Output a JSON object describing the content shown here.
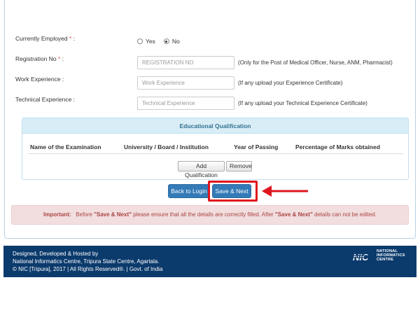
{
  "form": {
    "employed": {
      "label": "Currently Employed",
      "required": "*",
      "suffix": " :",
      "options": [
        "Yes",
        "No"
      ],
      "selected": "No"
    },
    "registration": {
      "label": "Registration No",
      "required": "*",
      "suffix": " :",
      "placeholder": "REGISTRATION NO",
      "hint": "(Only for the Post of Medical Officer, Nurse, ANM, Pharmacist)"
    },
    "work": {
      "label": "Work Experience :",
      "placeholder": "Work Experience",
      "hint": "(If any upload your Experience Certificate)"
    },
    "technical": {
      "label": "Technical Experience :",
      "placeholder": "Technical Experience",
      "hint": "(If any upload your Technical Experience Certificate)"
    }
  },
  "qualification": {
    "title": "Educational Qualification",
    "columns": [
      "Name of the Examination",
      "University / Board / Institution",
      "Year of Passing",
      "Percentage of Marks obtained"
    ],
    "add_label": "Add Qualification",
    "remove_label": "Remove"
  },
  "actions": {
    "back_label": "Back to Login",
    "save_label": "Save & Next"
  },
  "alert": {
    "important": "Important:",
    "text1": "Before ",
    "emph1": "\"Save & Next\"",
    "text2": " please ensure that all the details are correctly filled. After ",
    "emph2": "\"Save & Next\"",
    "text3": " details can not be edited."
  },
  "footer": {
    "line1": "Designed, Developed & Hosted by",
    "line2": "National Informatics Centre, Tripura State Centre, Agartala.",
    "line3": "© NIC [Tripura], 2017 | All Rights Reserved®. | Govt. of India",
    "logo_mark": "NIC",
    "logo_text": [
      "NATIONAL",
      "INFORMATICS",
      "CENTRE"
    ]
  },
  "colors": {
    "primary": "#337ab7",
    "highlight": "#e0141e",
    "footer_bg": "#0b3a6c",
    "alert_bg": "#f2dede"
  }
}
